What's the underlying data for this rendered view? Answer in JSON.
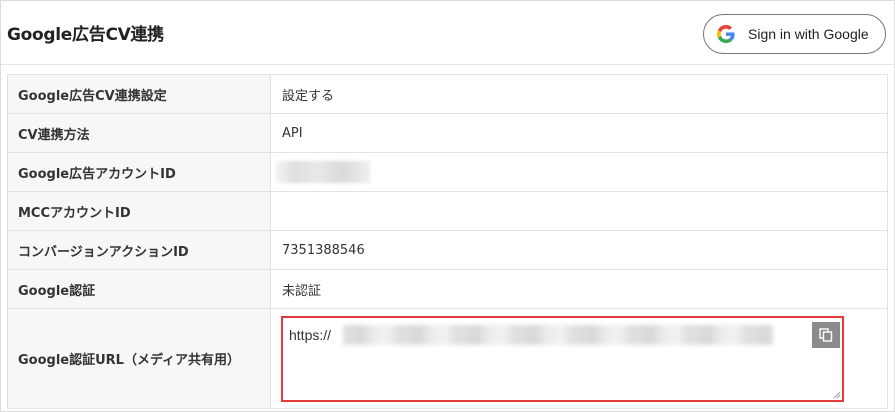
{
  "header": {
    "title": "Google広告CV連携",
    "signin_label": "Sign in with Google"
  },
  "rows": [
    {
      "label": "Google広告CV連携設定",
      "value": "設定する"
    },
    {
      "label": "CV連携方法",
      "value": "API"
    },
    {
      "label": "Google広告アカウントID",
      "value": ""
    },
    {
      "label": "MCCアカウントID",
      "value": ""
    },
    {
      "label": "コンバージョンアクションID",
      "value": "7351388546"
    },
    {
      "label": "Google認証",
      "value": "未認証"
    },
    {
      "label": "Google認証URL（メディア共有用）",
      "value": "https://"
    }
  ],
  "icons": {
    "google": "google-g-icon",
    "copy": "copy-icon"
  },
  "colors": {
    "highlight_border": "#e43a3a",
    "copy_button": "#8b8b8b",
    "label_bg": "#f7f7f7"
  }
}
